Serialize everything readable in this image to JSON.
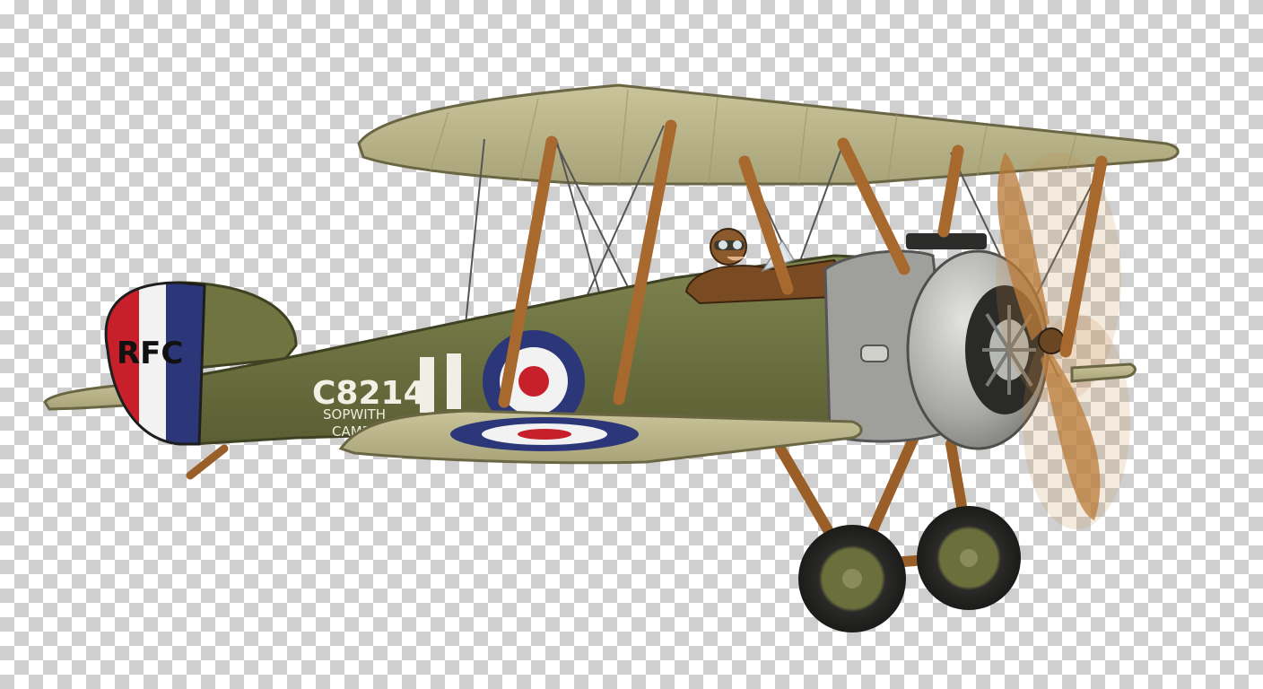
{
  "aircraft": {
    "tail_code": "RFC",
    "serial": "C8214",
    "name_line1": "SOPWITH",
    "name_line2": "CAMEL"
  },
  "colors": {
    "fuselage": "#6f7440",
    "wing": "#b9b48a",
    "strut": "#a8692e",
    "cowling": "#a9aaa6",
    "roundel_blue": "#2b3779",
    "roundel_red": "#c8202a",
    "tail_white": "#f2f2f2"
  }
}
